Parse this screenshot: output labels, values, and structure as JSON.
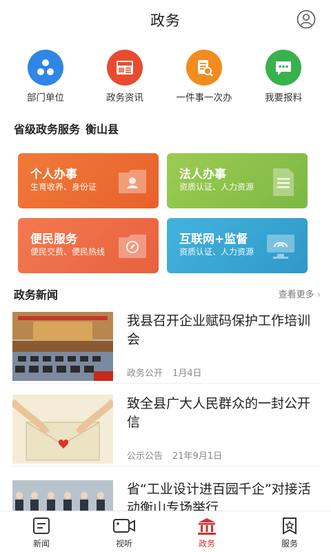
{
  "header": {
    "title": "政务"
  },
  "quick": [
    {
      "label": "部门单位",
      "icon": "departments-icon",
      "color": "#2f86e6"
    },
    {
      "label": "政务资讯",
      "icon": "news-icon",
      "color": "#e84c2f"
    },
    {
      "label": "一件事一次办",
      "icon": "one-stop-icon",
      "color": "#f28c1e"
    },
    {
      "label": "我要报料",
      "icon": "report-icon",
      "color": "#37b24d"
    }
  ],
  "services": {
    "title": "省级政务服务",
    "county": "衡山县",
    "cards": [
      {
        "title": "个人办事",
        "sub": "生育收养、身份证",
        "color": "#ee7134"
      },
      {
        "title": "法人办事",
        "sub": "资质认证、人力资源",
        "color": "#8cc24b"
      },
      {
        "title": "便民服务",
        "sub": "便民交费、便民热线",
        "color": "#ee6f45"
      },
      {
        "title": "互联网+监督",
        "sub": "资质认证、人力资源",
        "color": "#3aa8d6"
      }
    ]
  },
  "news": {
    "title": "政务新闻",
    "more": "查看更多",
    "items": [
      {
        "title": "我县召开企业赋码保护工作培训会",
        "source": "政务公开",
        "date": "1月4日"
      },
      {
        "title": "致全县广大人民群众的一封公开信",
        "source": "公示公告",
        "date": "21年9月1日"
      },
      {
        "title": "省“工业设计进百园千企”对接活动衡山专场举行",
        "source": "",
        "date": ""
      }
    ]
  },
  "tabs": [
    {
      "label": "新闻",
      "icon": "news-tab-icon",
      "active": false
    },
    {
      "label": "视听",
      "icon": "video-tab-icon",
      "active": false
    },
    {
      "label": "政务",
      "icon": "government-tab-icon",
      "active": true
    },
    {
      "label": "服务",
      "icon": "service-tab-icon",
      "active": false
    }
  ],
  "accent": "#d32f2f"
}
